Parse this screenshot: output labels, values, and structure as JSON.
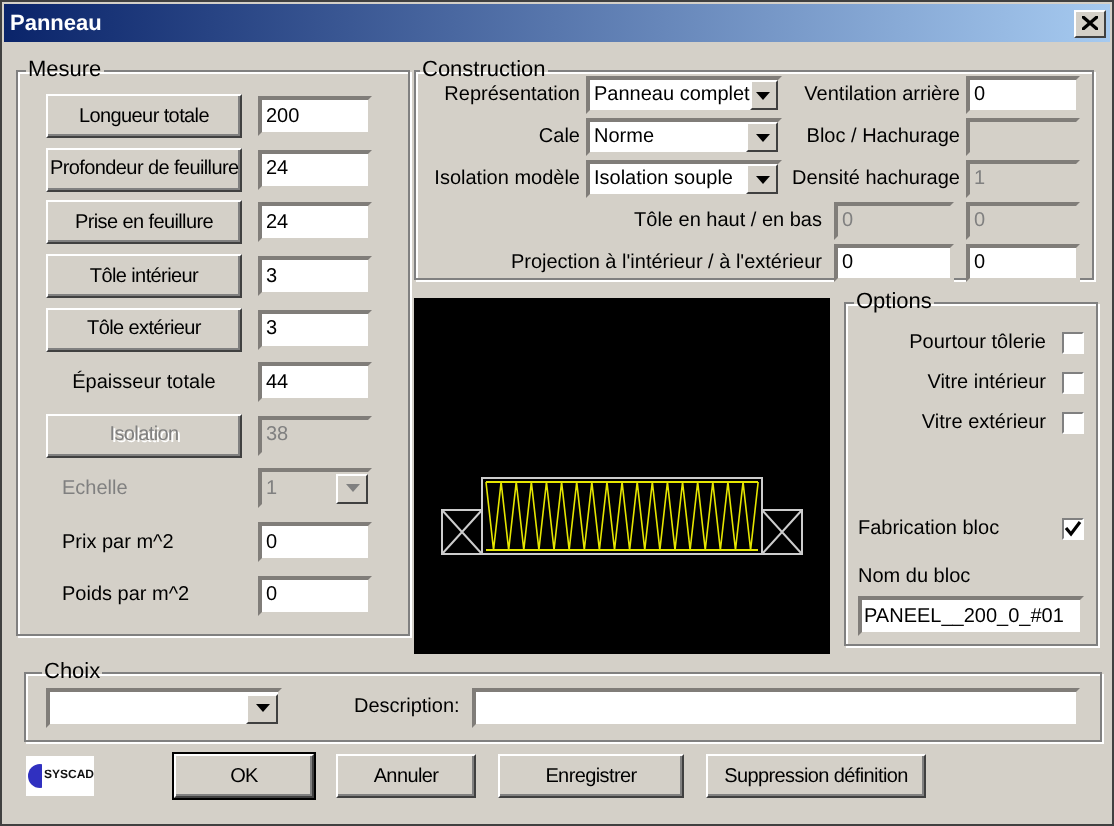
{
  "window": {
    "title": "Panneau"
  },
  "mesure": {
    "title": "Mesure",
    "rows": [
      {
        "kind": "button",
        "label": "Longueur totale",
        "value": "200",
        "disabled": false
      },
      {
        "kind": "button",
        "label": "Profondeur de feuillure",
        "value": "24",
        "disabled": false
      },
      {
        "kind": "button",
        "label": "Prise en feuillure",
        "value": "24",
        "disabled": false
      },
      {
        "kind": "button",
        "label": "Tôle intérieur",
        "value": "3",
        "disabled": false
      },
      {
        "kind": "button",
        "label": "Tôle extérieur",
        "value": "3",
        "disabled": false
      },
      {
        "kind": "centered",
        "label": "Épaisseur totale",
        "value": "44",
        "disabled": false
      },
      {
        "kind": "button",
        "label": "Isolation",
        "value": "38",
        "disabled": true
      },
      {
        "kind": "select",
        "label": "Echelle",
        "value": "1",
        "disabled": true
      },
      {
        "kind": "label",
        "label": "Prix par m^2",
        "value": "0",
        "disabled": false
      },
      {
        "kind": "label",
        "label": "Poids par m^2",
        "value": "0",
        "disabled": false
      }
    ]
  },
  "construction": {
    "title": "Construction",
    "grid_rows": [
      {
        "label": "Représentation",
        "select": "Panneau complet",
        "field_label": "Ventilation arrière",
        "field": {
          "value": "0",
          "disabled": false
        }
      },
      {
        "label": "Cale",
        "select": "Norme",
        "field_label": "Bloc  / Hachurage",
        "field": {
          "disabled": true
        }
      },
      {
        "label": "Isolation  modèle",
        "select": "Isolation souple",
        "field_label": "Densité hachurage",
        "field": {
          "value": "1",
          "disabled": true
        }
      }
    ],
    "pair_rows": [
      {
        "label": "Tôle en haut / en bas",
        "fields": [
          {
            "value": "0",
            "disabled": true
          },
          {
            "value": "0",
            "disabled": true
          }
        ]
      },
      {
        "label": "Projection à l'intérieur / à l'extérieur",
        "fields": [
          {
            "value": "0",
            "disabled": false
          },
          {
            "value": "0",
            "disabled": false
          }
        ]
      }
    ]
  },
  "options": {
    "title": "Options",
    "checks": [
      {
        "label": "Pourtour tôlerie",
        "checked": false
      },
      {
        "label": "Vitre intérieur",
        "checked": false
      },
      {
        "label": "Vitre extérieur",
        "checked": false
      }
    ],
    "block": {
      "label": "Fabrication bloc",
      "checked": true
    },
    "name_label": "Nom du bloc",
    "name_value": "PANEEL__200_0_#01"
  },
  "choix": {
    "title": "Choix",
    "description_label": "Description:"
  },
  "logo": {
    "text": "SYSCAD"
  },
  "buttons": [
    {
      "label": "OK",
      "default": true
    },
    {
      "label": "Annuler",
      "default": false
    },
    {
      "label": "Enregistrer",
      "default": false
    },
    {
      "label": "Suppression définition",
      "default": false
    }
  ]
}
